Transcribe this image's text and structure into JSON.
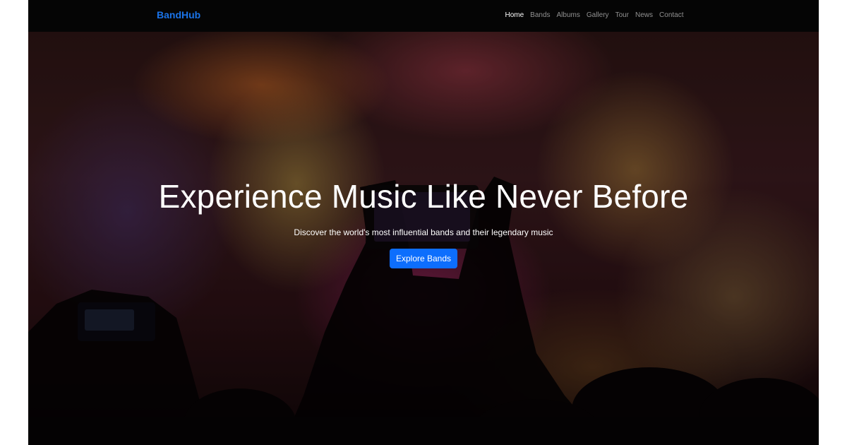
{
  "navbar": {
    "brand": "BandHub",
    "links": [
      {
        "label": "Home",
        "active": true
      },
      {
        "label": "Bands",
        "active": false
      },
      {
        "label": "Albums",
        "active": false
      },
      {
        "label": "Gallery",
        "active": false
      },
      {
        "label": "Tour",
        "active": false
      },
      {
        "label": "News",
        "active": false
      },
      {
        "label": "Contact",
        "active": false
      }
    ]
  },
  "hero": {
    "title": "Experience Music Like Never Before",
    "subtitle": "Discover the world's most influential bands and their legendary music",
    "cta_label": "Explore Bands",
    "background_image": "concert-crowd-photo"
  },
  "colors": {
    "brand": "#1a73e8",
    "button": "#0d6efd",
    "navbar_bg": "#050505",
    "text": "#ffffff"
  }
}
